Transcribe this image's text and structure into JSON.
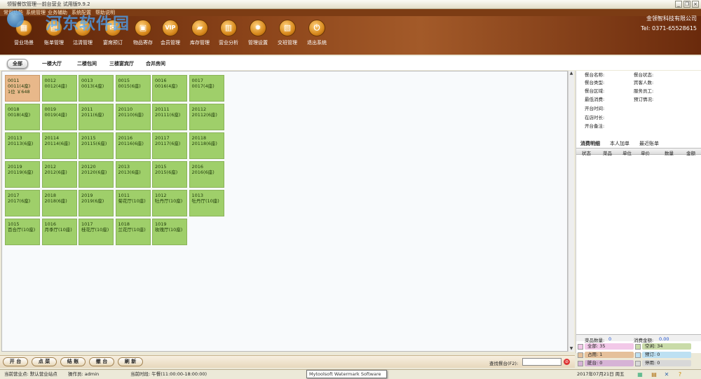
{
  "window": {
    "title": "领智餐饮管理---前台营业 试用版9.9.2"
  },
  "menu": [
    "常用功能",
    "系统管理",
    "业务辅助",
    "系统配置",
    "帮助说明"
  ],
  "watermark": "河东软件园",
  "toolbar": [
    {
      "label": "营业场景",
      "icon": "scene-icon",
      "glyph": "▦"
    },
    {
      "label": "账单管理",
      "icon": "bill-icon",
      "glyph": "▤"
    },
    {
      "label": "沽清管理",
      "icon": "soldout-icon",
      "glyph": "✎"
    },
    {
      "label": "宴席预订",
      "icon": "banquet-icon",
      "glyph": "✉"
    },
    {
      "label": "物品寄存",
      "icon": "storage-icon",
      "glyph": "▣"
    },
    {
      "label": "会员管理",
      "icon": "vip-icon",
      "glyph": "VIP"
    },
    {
      "label": "库存管理",
      "icon": "folder-icon",
      "glyph": "▰"
    },
    {
      "label": "营业分析",
      "icon": "chart-icon",
      "glyph": "▥"
    },
    {
      "label": "管理设置",
      "icon": "gear-icon",
      "glyph": "✹"
    },
    {
      "label": "交班管理",
      "icon": "handover-icon",
      "glyph": "▧"
    },
    {
      "label": "退出系统",
      "icon": "power-icon",
      "glyph": "⏻"
    }
  ],
  "company": {
    "name": "金领智科技有限公司",
    "tel": "Tel: 0371-65528615"
  },
  "filters": [
    "全部",
    "一楼大厅",
    "二楼包间",
    "三楼宴宾厅",
    "合并房间"
  ],
  "tables": [
    {
      "l1": "0011",
      "l2": "0011(4座)",
      "l3": "1位 ￥648",
      "occupied": true
    },
    {
      "l1": "0012",
      "l2": "0012(4座)"
    },
    {
      "l1": "0013",
      "l2": "0013(4座)"
    },
    {
      "l1": "0015",
      "l2": "0015(6座)"
    },
    {
      "l1": "0016",
      "l2": "0016(4座)"
    },
    {
      "l1": "0017",
      "l2": "0017(4座)"
    },
    {
      "l1": "0018",
      "l2": "0018(4座)"
    },
    {
      "l1": "0019",
      "l2": "0019(4座)"
    },
    {
      "l1": "2011",
      "l2": "2011(6座)"
    },
    {
      "l1": "20110",
      "l2": "20110(6座)"
    },
    {
      "l1": "20111",
      "l2": "20111(6座)"
    },
    {
      "l1": "20112",
      "l2": "20112(6座)"
    },
    {
      "l1": "20113",
      "l2": "20113(6座)"
    },
    {
      "l1": "20114",
      "l2": "20114(6座)"
    },
    {
      "l1": "20115",
      "l2": "20115(6座)"
    },
    {
      "l1": "20116",
      "l2": "20116(6座)"
    },
    {
      "l1": "20117",
      "l2": "20117(6座)"
    },
    {
      "l1": "20118",
      "l2": "20118(6座)"
    },
    {
      "l1": "20119",
      "l2": "20119(6座)"
    },
    {
      "l1": "2012",
      "l2": "2012(6座)"
    },
    {
      "l1": "20120",
      "l2": "20120(6座)"
    },
    {
      "l1": "2013",
      "l2": "2013(6座)"
    },
    {
      "l1": "2015",
      "l2": "2015(6座)"
    },
    {
      "l1": "2016",
      "l2": "2016(6座)"
    },
    {
      "l1": "2017",
      "l2": "2017(6座)"
    },
    {
      "l1": "2018",
      "l2": "2018(6座)"
    },
    {
      "l1": "2019",
      "l2": "2019(6座)"
    },
    {
      "l1": "1011",
      "l2": "菊花厅(10座)"
    },
    {
      "l1": "1012",
      "l2": "牡丹厅(10座)"
    },
    {
      "l1": "1013",
      "l2": "牡丹厅(10座)"
    },
    {
      "l1": "1015",
      "l2": "百合厅(10座)"
    },
    {
      "l1": "1016",
      "l2": "月季厅(10座)"
    },
    {
      "l1": "1017",
      "l2": "桂花厅(10座)"
    },
    {
      "l1": "1018",
      "l2": "兰花厅(10座)"
    },
    {
      "l1": "1019",
      "l2": "玫瑰厅(10座)"
    }
  ],
  "info": {
    "left": [
      "餐台名称:",
      "餐台类型:",
      "餐台区域:",
      "最低消费:",
      "开台时间:",
      "在店时长:",
      "开台备注:"
    ],
    "right": [
      "餐台状态:",
      "宾客人数:",
      "服务员工:",
      "预订情况:"
    ]
  },
  "detail_tabs": [
    "消费明细",
    "本人加单",
    "最近账单"
  ],
  "detail_cols": [
    "状态",
    "菜品",
    "单位",
    "单价",
    "数量",
    "金额"
  ],
  "summary": {
    "dish_label": "菜品数量:",
    "dish_value": "0",
    "amount_label": "消费金额:",
    "amount_value": "0.00"
  },
  "legend": [
    {
      "label": "全部: 35",
      "color": "#f2c8e8"
    },
    {
      "label": "空闲: 34",
      "color": "#c9dba8"
    },
    {
      "label": "占用: 1",
      "color": "#e5c09a"
    },
    {
      "label": "预订: 0",
      "color": "#bde0f2"
    },
    {
      "label": "脏台: 0",
      "color": "#d6b3d6"
    },
    {
      "label": "停用: 0",
      "color": "#d8d8d8"
    }
  ],
  "actions": [
    "开 台",
    "点 菜",
    "结 账",
    "撤 台",
    "刷 新"
  ],
  "search": {
    "label": "查找餐台(F2):",
    "value": ""
  },
  "status": {
    "site": "当前营业点: 默认营业站点",
    "operator": "操作员: admin",
    "shift": "当前时段: 午餐(11:00:00-18:00:00)",
    "date": "2017年07月21日 周五"
  },
  "tooltip": "Mytoolsoft Watermark Software 3.0"
}
